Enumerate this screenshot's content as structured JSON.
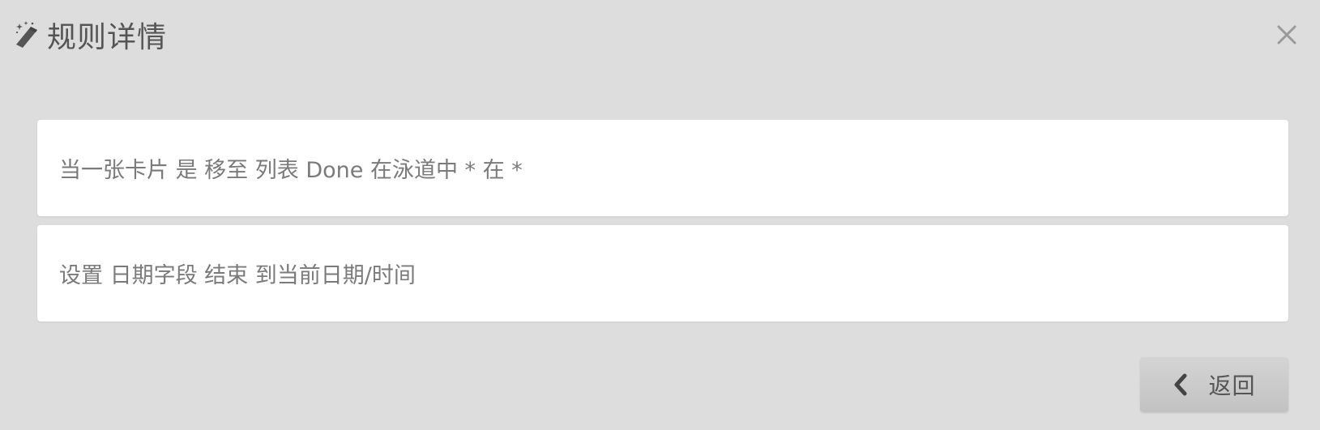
{
  "dialog": {
    "title": "规则详情",
    "title_icon": "magic-wand-icon",
    "close_icon": "close-icon"
  },
  "rule": {
    "trigger_text": "当一张卡片 是 移至 列表 Done 在泳道中 * 在 *",
    "action_text": "设置 日期字段 结束 到当前日期/时间"
  },
  "footer": {
    "back_label": "返回",
    "back_icon": "chevron-left-icon"
  },
  "colors": {
    "background": "#dddddd",
    "card": "#ffffff",
    "button": "#c9c9c9",
    "text": "#7a7a7a"
  }
}
